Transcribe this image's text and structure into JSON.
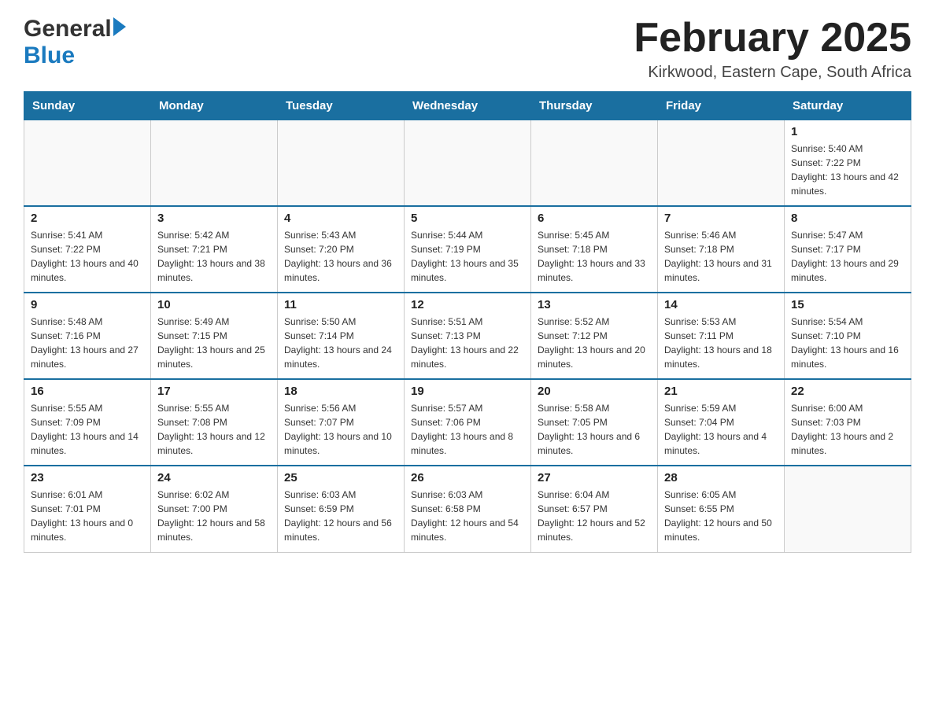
{
  "header": {
    "logo_general": "General",
    "logo_blue": "Blue",
    "month_title": "February 2025",
    "location": "Kirkwood, Eastern Cape, South Africa"
  },
  "calendar": {
    "days_of_week": [
      "Sunday",
      "Monday",
      "Tuesday",
      "Wednesday",
      "Thursday",
      "Friday",
      "Saturday"
    ],
    "weeks": [
      [
        {
          "day": "",
          "info": ""
        },
        {
          "day": "",
          "info": ""
        },
        {
          "day": "",
          "info": ""
        },
        {
          "day": "",
          "info": ""
        },
        {
          "day": "",
          "info": ""
        },
        {
          "day": "",
          "info": ""
        },
        {
          "day": "1",
          "info": "Sunrise: 5:40 AM\nSunset: 7:22 PM\nDaylight: 13 hours and 42 minutes."
        }
      ],
      [
        {
          "day": "2",
          "info": "Sunrise: 5:41 AM\nSunset: 7:22 PM\nDaylight: 13 hours and 40 minutes."
        },
        {
          "day": "3",
          "info": "Sunrise: 5:42 AM\nSunset: 7:21 PM\nDaylight: 13 hours and 38 minutes."
        },
        {
          "day": "4",
          "info": "Sunrise: 5:43 AM\nSunset: 7:20 PM\nDaylight: 13 hours and 36 minutes."
        },
        {
          "day": "5",
          "info": "Sunrise: 5:44 AM\nSunset: 7:19 PM\nDaylight: 13 hours and 35 minutes."
        },
        {
          "day": "6",
          "info": "Sunrise: 5:45 AM\nSunset: 7:18 PM\nDaylight: 13 hours and 33 minutes."
        },
        {
          "day": "7",
          "info": "Sunrise: 5:46 AM\nSunset: 7:18 PM\nDaylight: 13 hours and 31 minutes."
        },
        {
          "day": "8",
          "info": "Sunrise: 5:47 AM\nSunset: 7:17 PM\nDaylight: 13 hours and 29 minutes."
        }
      ],
      [
        {
          "day": "9",
          "info": "Sunrise: 5:48 AM\nSunset: 7:16 PM\nDaylight: 13 hours and 27 minutes."
        },
        {
          "day": "10",
          "info": "Sunrise: 5:49 AM\nSunset: 7:15 PM\nDaylight: 13 hours and 25 minutes."
        },
        {
          "day": "11",
          "info": "Sunrise: 5:50 AM\nSunset: 7:14 PM\nDaylight: 13 hours and 24 minutes."
        },
        {
          "day": "12",
          "info": "Sunrise: 5:51 AM\nSunset: 7:13 PM\nDaylight: 13 hours and 22 minutes."
        },
        {
          "day": "13",
          "info": "Sunrise: 5:52 AM\nSunset: 7:12 PM\nDaylight: 13 hours and 20 minutes."
        },
        {
          "day": "14",
          "info": "Sunrise: 5:53 AM\nSunset: 7:11 PM\nDaylight: 13 hours and 18 minutes."
        },
        {
          "day": "15",
          "info": "Sunrise: 5:54 AM\nSunset: 7:10 PM\nDaylight: 13 hours and 16 minutes."
        }
      ],
      [
        {
          "day": "16",
          "info": "Sunrise: 5:55 AM\nSunset: 7:09 PM\nDaylight: 13 hours and 14 minutes."
        },
        {
          "day": "17",
          "info": "Sunrise: 5:55 AM\nSunset: 7:08 PM\nDaylight: 13 hours and 12 minutes."
        },
        {
          "day": "18",
          "info": "Sunrise: 5:56 AM\nSunset: 7:07 PM\nDaylight: 13 hours and 10 minutes."
        },
        {
          "day": "19",
          "info": "Sunrise: 5:57 AM\nSunset: 7:06 PM\nDaylight: 13 hours and 8 minutes."
        },
        {
          "day": "20",
          "info": "Sunrise: 5:58 AM\nSunset: 7:05 PM\nDaylight: 13 hours and 6 minutes."
        },
        {
          "day": "21",
          "info": "Sunrise: 5:59 AM\nSunset: 7:04 PM\nDaylight: 13 hours and 4 minutes."
        },
        {
          "day": "22",
          "info": "Sunrise: 6:00 AM\nSunset: 7:03 PM\nDaylight: 13 hours and 2 minutes."
        }
      ],
      [
        {
          "day": "23",
          "info": "Sunrise: 6:01 AM\nSunset: 7:01 PM\nDaylight: 13 hours and 0 minutes."
        },
        {
          "day": "24",
          "info": "Sunrise: 6:02 AM\nSunset: 7:00 PM\nDaylight: 12 hours and 58 minutes."
        },
        {
          "day": "25",
          "info": "Sunrise: 6:03 AM\nSunset: 6:59 PM\nDaylight: 12 hours and 56 minutes."
        },
        {
          "day": "26",
          "info": "Sunrise: 6:03 AM\nSunset: 6:58 PM\nDaylight: 12 hours and 54 minutes."
        },
        {
          "day": "27",
          "info": "Sunrise: 6:04 AM\nSunset: 6:57 PM\nDaylight: 12 hours and 52 minutes."
        },
        {
          "day": "28",
          "info": "Sunrise: 6:05 AM\nSunset: 6:55 PM\nDaylight: 12 hours and 50 minutes."
        },
        {
          "day": "",
          "info": ""
        }
      ]
    ]
  }
}
